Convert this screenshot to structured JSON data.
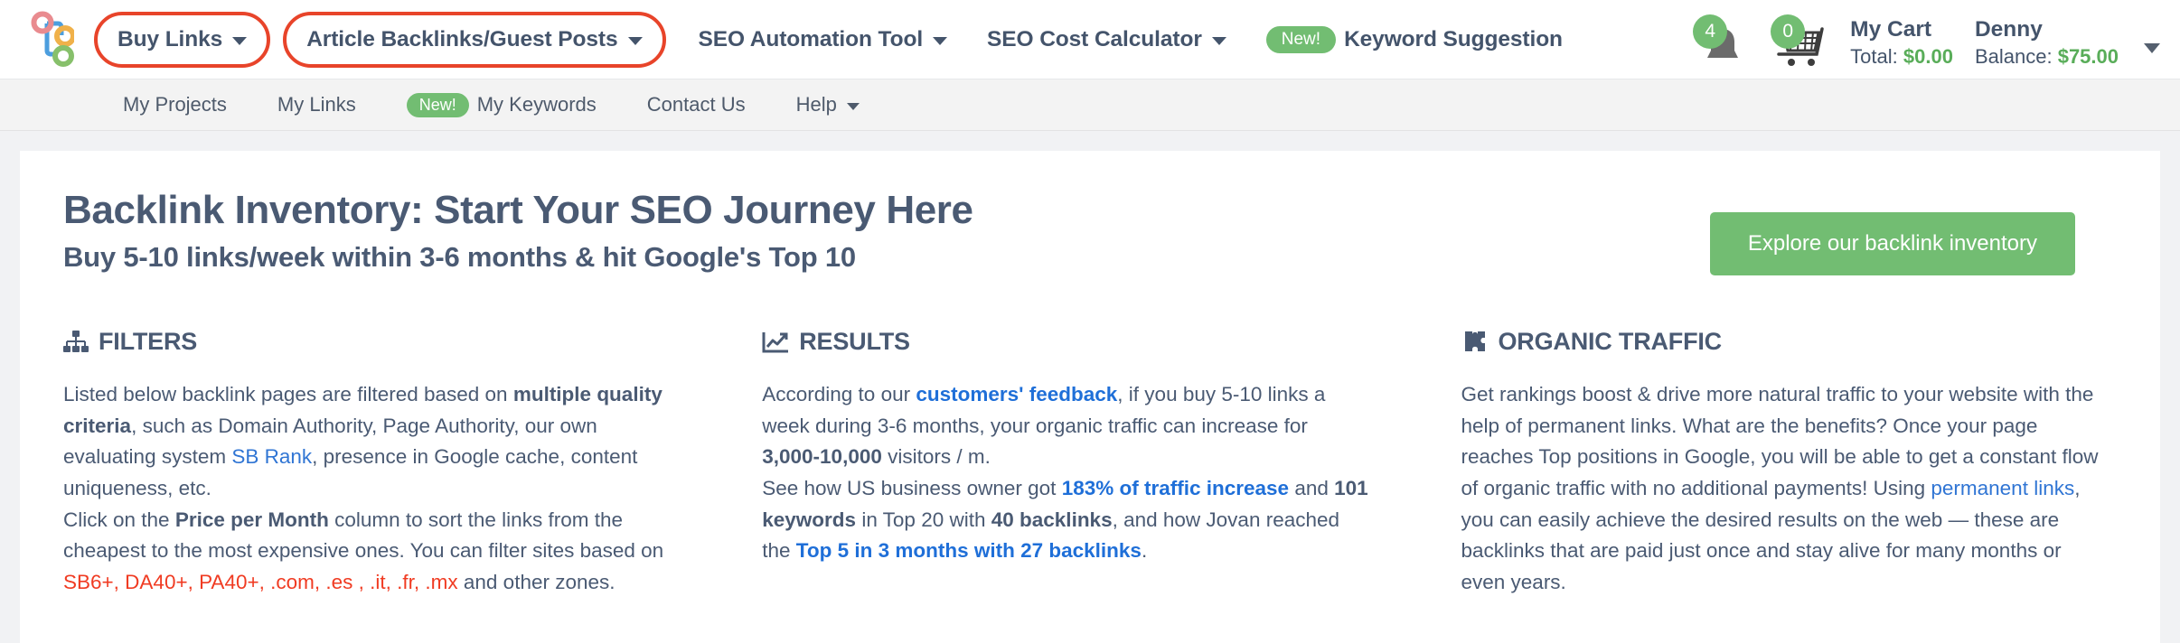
{
  "brand": {
    "logo_name": "sitechecker-tree-logo"
  },
  "top_nav": {
    "items": [
      {
        "label": "Buy Links",
        "has_caret": true,
        "highlighted": true,
        "badge": null
      },
      {
        "label": "Article Backlinks/Guest Posts",
        "has_caret": true,
        "highlighted": true,
        "badge": null
      },
      {
        "label": "SEO Automation Tool",
        "has_caret": true,
        "highlighted": false,
        "badge": null
      },
      {
        "label": "SEO Cost Calculator",
        "has_caret": true,
        "highlighted": false,
        "badge": null
      },
      {
        "label": "Keyword Suggestion",
        "has_caret": false,
        "highlighted": false,
        "badge": "New!"
      }
    ]
  },
  "user_area": {
    "notifications_count": "4",
    "cart_count": "0",
    "cart_title": "My Cart",
    "cart_total_label": "Total:",
    "cart_total_amount": "$0.00",
    "user_name": "Denny",
    "balance_label": "Balance:",
    "balance_amount": "$75.00"
  },
  "sub_nav": {
    "items": [
      {
        "label": "My Projects",
        "badge": null,
        "has_caret": false
      },
      {
        "label": "My Links",
        "badge": null,
        "has_caret": false
      },
      {
        "label": "My Keywords",
        "badge": "New!",
        "has_caret": false
      },
      {
        "label": "Contact Us",
        "badge": null,
        "has_caret": false
      },
      {
        "label": "Help",
        "badge": null,
        "has_caret": true
      }
    ]
  },
  "hero": {
    "title": "Backlink Inventory: Start Your SEO Journey Here",
    "subtitle": "Buy 5-10 links/week within 3-6 months & hit Google's Top 10",
    "cta_label": "Explore our backlink inventory"
  },
  "columns": {
    "filters": {
      "icon": "sitemap-icon",
      "heading": "FILTERS",
      "p1_a": "Listed below backlink pages are filtered based on ",
      "p1_bold1": "multiple quality criteria",
      "p1_b": ", such as Domain Authority, Page Authority, our own evaluating system ",
      "p1_link": "SB Rank",
      "p1_c": ", presence in Google cache, content uniqueness, etc.",
      "p2_a": "Click on the ",
      "p2_bold1": "Price per Month",
      "p2_b": " column to sort the links from the cheapest to the most expensive ones. You can filter sites based on ",
      "p2_red": "SB6+, DA40+, PA40+, .com, .es , .it, .fr, .mx",
      "p2_c": " and other zones."
    },
    "results": {
      "icon": "chart-line-icon",
      "heading": "RESULTS",
      "p1_a": "According to our ",
      "p1_link": "customers' feedback",
      "p1_b": ", if you buy 5-10 links a week during 3-6 months, your organic traffic can increase for ",
      "p1_bold1": "3,000-10,000",
      "p1_c": " visitors / m.",
      "p2_a": "See how US business owner got ",
      "p2_link1": "183% of traffic increase",
      "p2_b": " and ",
      "p2_bold1": "101 keywords",
      "p2_c": " in Top 20 with ",
      "p2_bold2": "40 backlinks",
      "p2_d": ", and how Jovan reached the ",
      "p2_link2": "Top 5 in 3 months with 27 backlinks",
      "p2_e": "."
    },
    "organic": {
      "icon": "puzzle-piece-icon",
      "heading": "ORGANIC TRAFFIC",
      "p1_a": "Get rankings boost & drive more natural traffic to your website with the help of permanent links. What are the benefits? Once your page reaches Top positions in Google, you will be able to get a constant flow of organic traffic with no additional payments! Using ",
      "p1_link": "permanent links",
      "p1_b": ", you can easily achieve the desired results on the web — these are backlinks that are paid just once and stay alive for many months or even years."
    }
  },
  "colors": {
    "accent_green": "#72bd72",
    "highlight_red": "#e8442a",
    "text_slate": "#4a5a73",
    "link_blue": "#3075d4"
  }
}
